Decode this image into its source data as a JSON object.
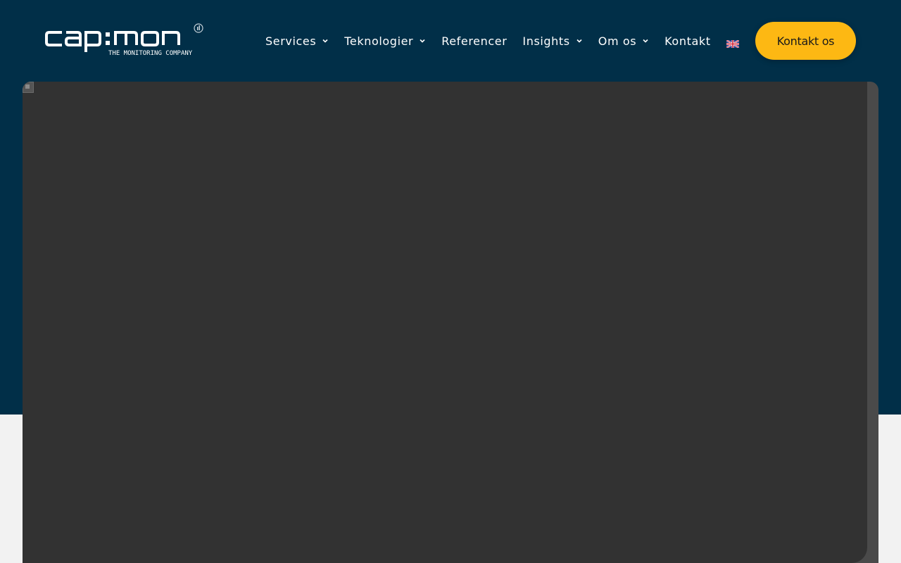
{
  "brand": {
    "name": "cap:mon",
    "tagline": "THE MONITORING COMPANY"
  },
  "nav": {
    "items": [
      {
        "label": "Services",
        "has_dropdown": true
      },
      {
        "label": "Teknologier",
        "has_dropdown": true
      },
      {
        "label": "Referencer",
        "has_dropdown": false
      },
      {
        "label": "Insights",
        "has_dropdown": true
      },
      {
        "label": "Om os",
        "has_dropdown": true
      },
      {
        "label": "Kontakt",
        "has_dropdown": false
      }
    ],
    "language_icon": "uk-flag-icon"
  },
  "cta": {
    "label": "Kontakt os"
  },
  "colors": {
    "header_bg": "#012f48",
    "accent": "#fdb813",
    "page_bg": "#f2f2f2",
    "media_bg": "#323232"
  }
}
